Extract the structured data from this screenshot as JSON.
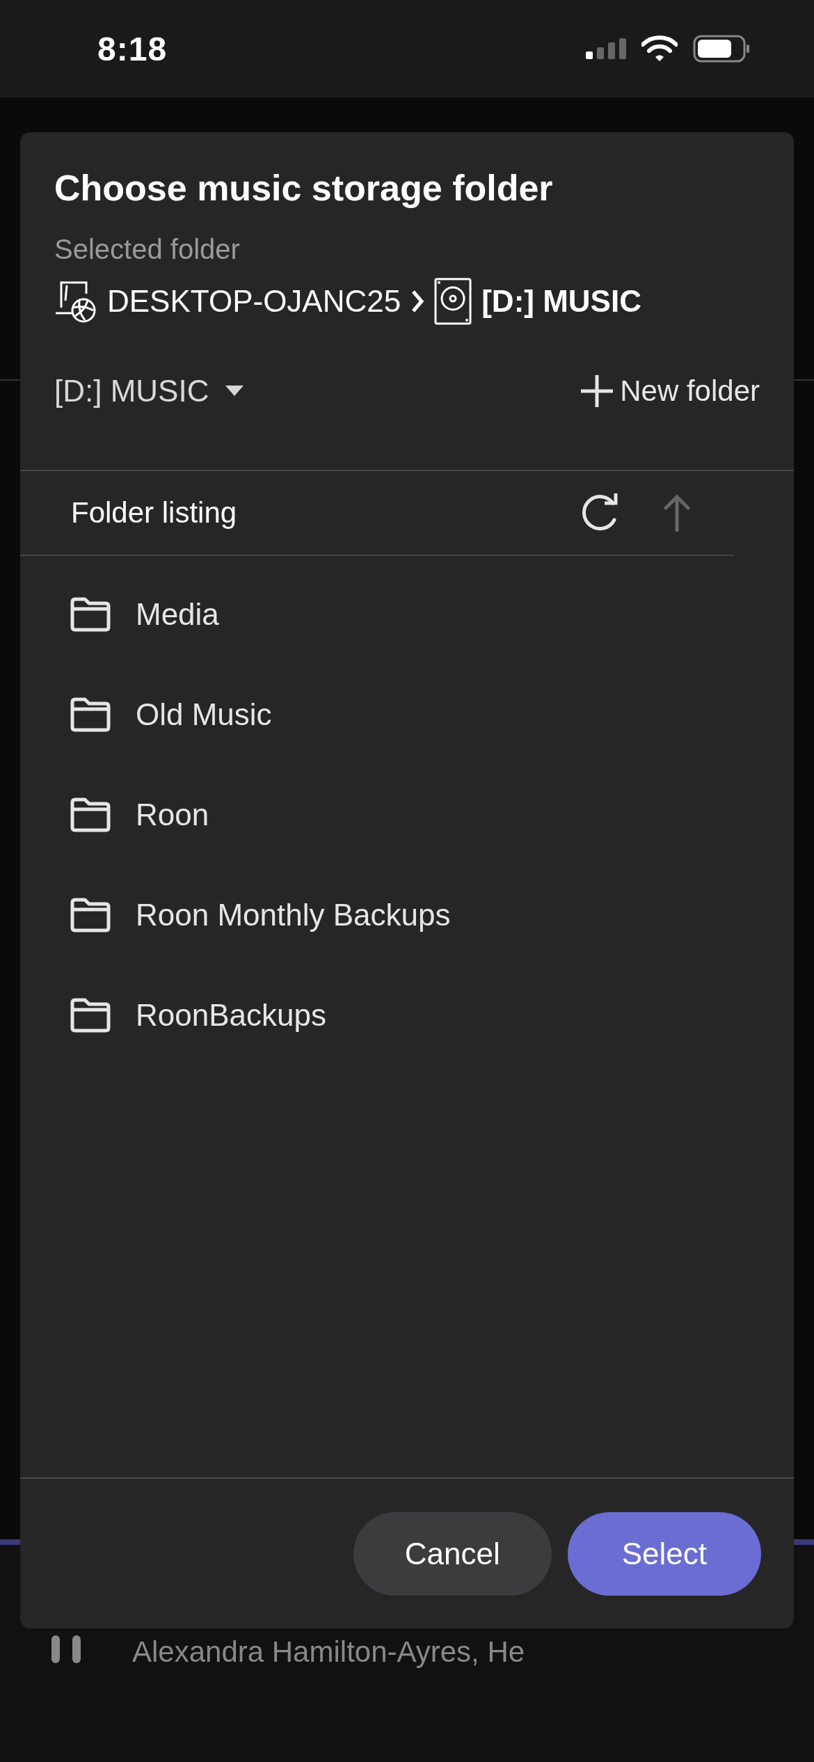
{
  "status_bar": {
    "time": "8:18"
  },
  "dialog": {
    "title": "Choose music storage folder",
    "selected_label": "Selected folder",
    "breadcrumb": [
      {
        "label": "DESKTOP-OJANC25",
        "kind": "computer"
      },
      {
        "label": "[D:] MUSIC",
        "kind": "drive"
      }
    ],
    "drive_dropdown": {
      "value": "[D:] MUSIC"
    },
    "new_folder_button": "New folder",
    "listing": {
      "title": "Folder listing",
      "up_disabled": true,
      "folders": [
        "Media",
        "Old Music",
        "Roon",
        "Roon Monthly Backups",
        "RoonBackups"
      ]
    },
    "buttons": [
      {
        "label": "Cancel",
        "kind": "secondary"
      },
      {
        "label": "Select",
        "kind": "primary"
      }
    ]
  },
  "now_playing": {
    "artist": "Alexandra Hamilton-Ayres, He"
  }
}
